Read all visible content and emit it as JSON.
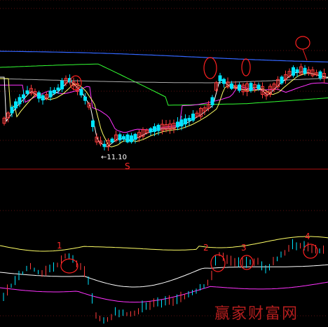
{
  "chart_data": [
    {
      "type": "candlestick",
      "panel": "price",
      "annotations": {
        "low_price_label": "←11.10",
        "signal_marker": "S"
      },
      "colors": {
        "up": "#ff3b3b",
        "down": "#00e5ff",
        "ma_short": "#ffffff",
        "ma_mid": "#ffff66",
        "ma_long1": "#ff33ff",
        "ma_long2": "#33ff33",
        "ma_long3": "#aaaaaa",
        "ma_long4": "#3366ff"
      }
    },
    {
      "type": "candlestick",
      "panel": "indicator",
      "markers": [
        "1",
        "2",
        "3",
        "4"
      ],
      "colors": {
        "upper_band": "#ffff66",
        "mid_band": "#ffffff",
        "lower_band": "#ff33ff"
      }
    }
  ],
  "watermark": "赢家财富网"
}
